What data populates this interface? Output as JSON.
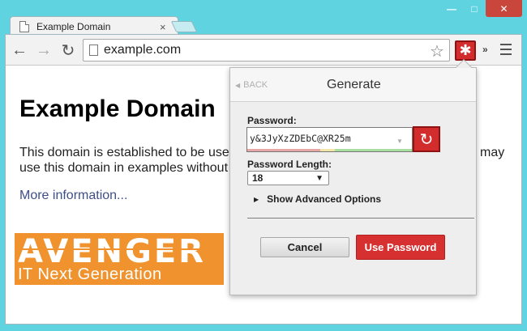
{
  "window": {
    "minimize_glyph": "—",
    "maximize_glyph": "□",
    "close_glyph": "✕"
  },
  "tab": {
    "title": "Example Domain",
    "close_glyph": "×"
  },
  "toolbar": {
    "back_glyph": "←",
    "forward_glyph": "→",
    "reload_glyph": "↻",
    "url": "example.com",
    "star_glyph": "☆",
    "extension_glyph": "✱",
    "overflow_glyph": "»"
  },
  "page": {
    "heading": "Example Domain",
    "paragraph_line1": "This domain is established to be used",
    "paragraph_line1_end": "may",
    "paragraph_line2": "use this domain in examples without p",
    "link": "More information..."
  },
  "logo": {
    "main": "AVENGER",
    "sub": "IT Next Generation"
  },
  "popup": {
    "back_label": "BACK",
    "title": "Generate",
    "password_label": "Password:",
    "password_value": "y&3JyXzZDEbC@XR25m",
    "regenerate_glyph": "↻",
    "length_label": "Password Length:",
    "length_value": "18",
    "advanced_label": "Show Advanced Options",
    "cancel_label": "Cancel",
    "use_label": "Use Password",
    "colors": {
      "accent": "#d63030",
      "strength_weak": "#e8a7a7",
      "strength_mid": "#f1e6a8",
      "strength_strong": "#a8dfa0"
    }
  }
}
